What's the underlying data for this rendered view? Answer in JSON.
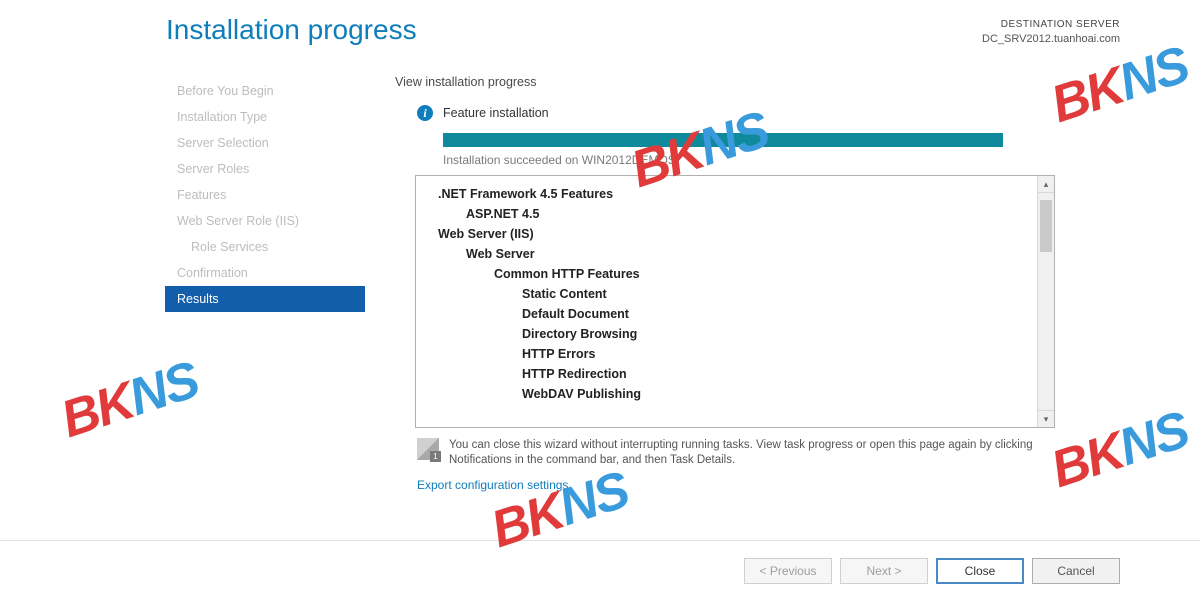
{
  "header": {
    "title": "Installation progress",
    "dest_label": "DESTINATION SERVER",
    "dest_value": "DC_SRV2012.tuanhoai.com"
  },
  "sidebar": {
    "items": [
      {
        "label": "Before You Begin",
        "indent": false,
        "active": false
      },
      {
        "label": "Installation Type",
        "indent": false,
        "active": false
      },
      {
        "label": "Server Selection",
        "indent": false,
        "active": false
      },
      {
        "label": "Server Roles",
        "indent": false,
        "active": false
      },
      {
        "label": "Features",
        "indent": false,
        "active": false
      },
      {
        "label": "Web Server Role (IIS)",
        "indent": false,
        "active": false
      },
      {
        "label": "Role Services",
        "indent": true,
        "active": false
      },
      {
        "label": "Confirmation",
        "indent": false,
        "active": false
      },
      {
        "label": "Results",
        "indent": false,
        "active": true
      }
    ]
  },
  "main": {
    "section_head": "View installation progress",
    "status_title": "Feature installation",
    "status_msg": "Installation succeeded on WIN2012DEMOS.",
    "features": [
      {
        "label": ".NET Framework 4.5 Features",
        "indent": 0,
        "bold": true
      },
      {
        "label": "ASP.NET 4.5",
        "indent": 1,
        "bold": true
      },
      {
        "label": "Web Server (IIS)",
        "indent": 0,
        "bold": true
      },
      {
        "label": "Web Server",
        "indent": 1,
        "bold": true
      },
      {
        "label": "Common HTTP Features",
        "indent": 2,
        "bold": true
      },
      {
        "label": "Static Content",
        "indent": 3,
        "bold": true
      },
      {
        "label": "Default Document",
        "indent": 3,
        "bold": true
      },
      {
        "label": "Directory Browsing",
        "indent": 3,
        "bold": true
      },
      {
        "label": "HTTP Errors",
        "indent": 3,
        "bold": true
      },
      {
        "label": "HTTP Redirection",
        "indent": 3,
        "bold": true
      },
      {
        "label": "WebDAV Publishing",
        "indent": 3,
        "bold": true
      }
    ],
    "note": "You can close this wizard without interrupting running tasks. View task progress or open this page again by clicking Notifications in the command bar, and then Task Details.",
    "export_link": "Export configuration settings"
  },
  "footer": {
    "previous": "< Previous",
    "next": "Next >",
    "close": "Close",
    "cancel": "Cancel"
  },
  "watermark": "BKNS"
}
